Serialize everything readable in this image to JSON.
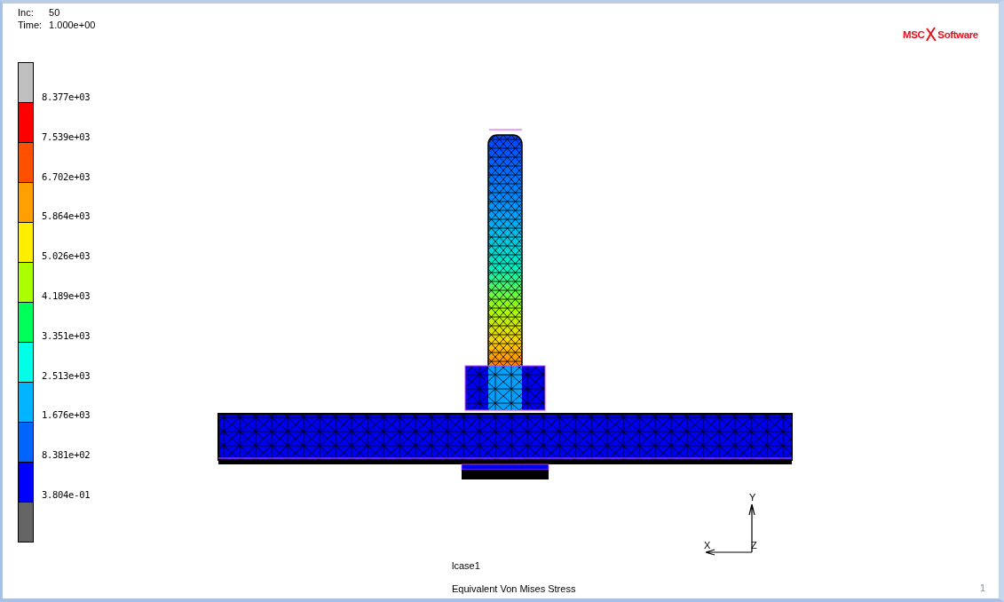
{
  "info": {
    "increment_label": "Inc:",
    "increment": "50",
    "time_label": "Time:",
    "time": "1.000e+00"
  },
  "logo": {
    "left": "MSC",
    "right": "Software"
  },
  "legend": {
    "bands": [
      {
        "color": "#c0c0c0"
      },
      {
        "color": "#ff0000"
      },
      {
        "color": "#ff5000"
      },
      {
        "color": "#ffa000"
      },
      {
        "color": "#ffee00"
      },
      {
        "color": "#aaff00"
      },
      {
        "color": "#00ff5a"
      },
      {
        "color": "#00ffe6"
      },
      {
        "color": "#00b4ff"
      },
      {
        "color": "#0064ff"
      },
      {
        "color": "#0000ff"
      },
      {
        "color": "#646464"
      }
    ],
    "labels": [
      "8.377e+03",
      "7.539e+03",
      "6.702e+03",
      "5.864e+03",
      "5.026e+03",
      "4.189e+03",
      "3.351e+03",
      "2.513e+03",
      "1.676e+03",
      "8.381e+02",
      "3.804e-01"
    ]
  },
  "axes": {
    "y": "Y",
    "x": "X",
    "z": "Z"
  },
  "footer": {
    "loadcase": "lcase1",
    "quantity": "Equivalent Von Mises Stress",
    "page": "1"
  }
}
